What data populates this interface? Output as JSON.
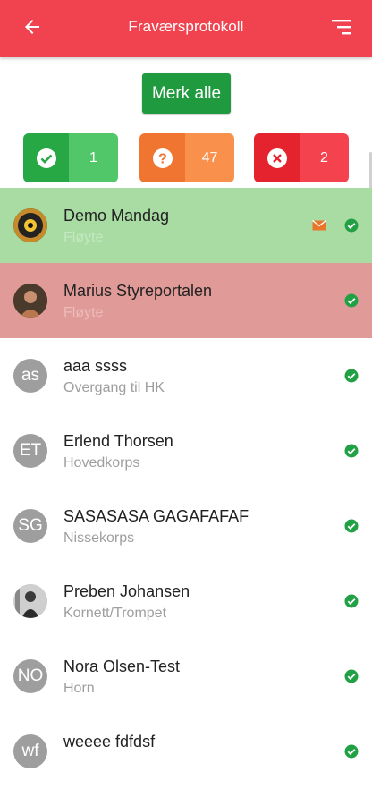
{
  "header": {
    "title": "Fraværsprotokoll",
    "back_icon": "arrow-left-icon",
    "menu_icon": "sort-menu-icon",
    "color": "#f0434f"
  },
  "actions": {
    "mark_all_label": "Merk alle"
  },
  "summary": {
    "present": {
      "icon": "check-circle-icon",
      "count": "1",
      "color": "#28a745"
    },
    "unknown": {
      "icon": "question-circle-icon",
      "count": "47",
      "color": "#f07530"
    },
    "absent": {
      "icon": "x-circle-icon",
      "count": "2",
      "color": "#e5232e"
    }
  },
  "members": [
    {
      "name": "Demo Mandag",
      "instrument": "Fløyte",
      "avatar": "photo",
      "state": "present",
      "has_mail": true
    },
    {
      "name": "Marius Styreportalen",
      "instrument": "Fløyte",
      "avatar": "photo",
      "state": "absent",
      "has_mail": false
    },
    {
      "name": "aaa ssss",
      "instrument": "Overgang til HK",
      "initials": "as",
      "state": "none",
      "has_mail": false
    },
    {
      "name": "Erlend Thorsen",
      "instrument": "Hovedkorps",
      "initials": "ET",
      "state": "none",
      "has_mail": false
    },
    {
      "name": "SASASASA GAGAFAFAF",
      "instrument": "Nissekorps",
      "initials": "SG",
      "state": "none",
      "has_mail": false
    },
    {
      "name": "Preben Johansen",
      "instrument": "Kornett/Trompet",
      "avatar": "photo",
      "state": "none",
      "has_mail": false
    },
    {
      "name": "Nora Olsen-Test",
      "instrument": "Horn",
      "initials": "NO",
      "state": "none",
      "has_mail": false
    },
    {
      "name": "weeee fdfdsf",
      "instrument": "",
      "initials": "wf",
      "state": "none",
      "has_mail": false
    }
  ]
}
